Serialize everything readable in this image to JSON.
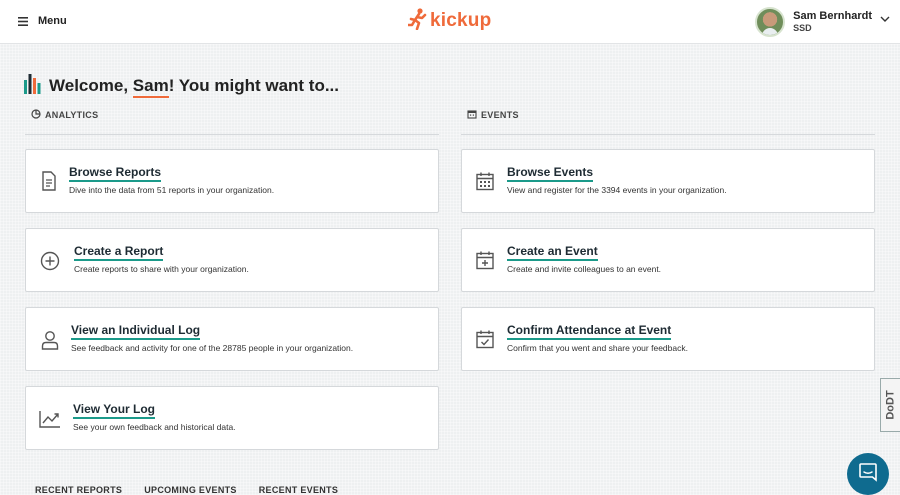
{
  "header": {
    "menu_label": "Menu",
    "logo_text": "kickup",
    "user": {
      "name": "Sam Bernhardt",
      "org": "SSD"
    }
  },
  "welcome": {
    "prefix": "Welcome, ",
    "name": "Sam",
    "suffix": "! You might want to..."
  },
  "sections": {
    "analytics_label": "ANALYTICS",
    "events_label": "EVENTS"
  },
  "analytics_cards": [
    {
      "title": "Browse Reports",
      "desc": "Dive into the data from 51 reports in your organization.",
      "icon": "document-icon"
    },
    {
      "title": "Create a Report",
      "desc": "Create reports to share with your organization.",
      "icon": "plus-circle-icon"
    },
    {
      "title": "View an Individual Log",
      "desc": "See feedback and activity for one of the 28785 people in your organization.",
      "icon": "person-icon"
    },
    {
      "title": "View Your Log",
      "desc": "See your own feedback and historical data.",
      "icon": "line-chart-icon"
    }
  ],
  "events_cards": [
    {
      "title": "Browse Events",
      "desc": "View and register for the 3394 events in your organization.",
      "icon": "calendar-icon"
    },
    {
      "title": "Create an Event",
      "desc": "Create and invite colleagues to an event.",
      "icon": "calendar-plus-icon"
    },
    {
      "title": "Confirm Attendance at Event",
      "desc": "Confirm that you went and share your feedback.",
      "icon": "calendar-check-icon"
    }
  ],
  "bottom_tabs": [
    "RECENT REPORTS",
    "UPCOMING EVENTS",
    "RECENT EVENTS"
  ],
  "side_tab_label": "DoDT",
  "colors": {
    "brand_orange": "#ef6a3a",
    "accent_teal": "#1b9a8a",
    "chat_blue": "#0f6b8f"
  }
}
